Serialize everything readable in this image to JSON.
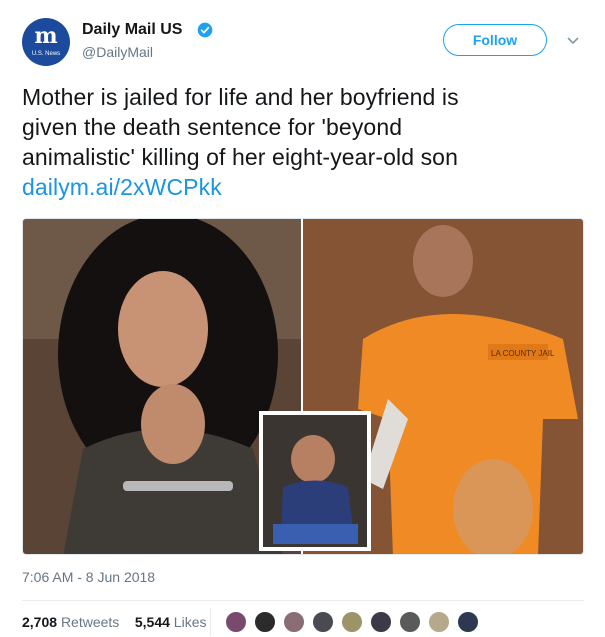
{
  "account": {
    "name": "Daily Mail US",
    "handle": "@DailyMail",
    "logo_text": "m",
    "logo_sub": "U.S. News"
  },
  "follow_label": "Follow",
  "tweet": {
    "lines": [
      "Mother is jailed for life and her boyfriend is",
      "given the death sentence for 'beyond",
      "animalistic' killing of her eight-year-old son"
    ],
    "link": "dailym.ai/2xWCPkk"
  },
  "timestamp": "7:06 AM - 8 Jun 2018",
  "stats": {
    "retweets_count": "2,708",
    "retweets_label": "Retweets",
    "likes_count": "5,544",
    "likes_label": "Likes"
  },
  "media_overlay_text": "LA COUNTY JAIL",
  "colors": {
    "accent": "#1da1f2",
    "link": "#1b95e0",
    "muted": "#657786",
    "brand": "#1c4a9c",
    "jumpsuit": "#f08a24"
  }
}
